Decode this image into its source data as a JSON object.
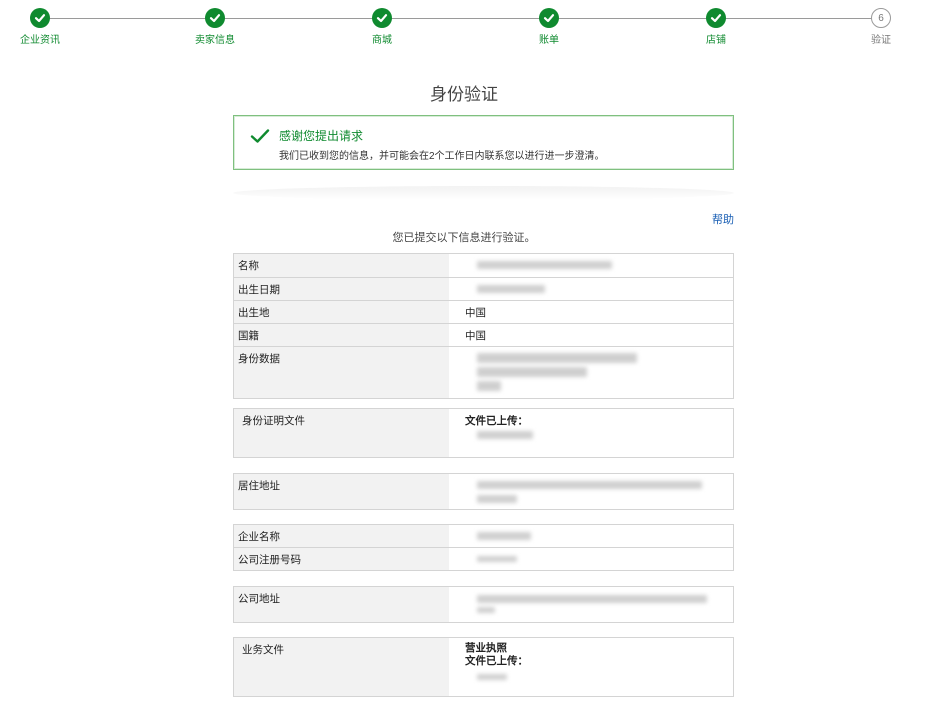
{
  "stepper": {
    "steps": [
      {
        "label": "企业资讯",
        "status": "done"
      },
      {
        "label": "卖家信息",
        "status": "done"
      },
      {
        "label": "商城",
        "status": "done"
      },
      {
        "label": "账单",
        "status": "done"
      },
      {
        "label": "店铺",
        "status": "done"
      },
      {
        "label": "验证",
        "status": "pending",
        "number": "6"
      }
    ]
  },
  "page_title": "身份验证",
  "success": {
    "title": "感谢您提出请求",
    "message": "我们已收到您的信息，并可能会在2个工作日内联系您以进行进一步澄清。",
    "icon": "checkmark-icon"
  },
  "help_label": "帮助",
  "submitted_note": "您已提交以下信息进行验证。",
  "identity": {
    "name_label": "名称",
    "birth_date_label": "出生日期",
    "birth_place_label": "出生地",
    "birth_place_value": "中国",
    "nationality_label": "国籍",
    "nationality_value": "中国",
    "id_data_label": "身份数据"
  },
  "id_proof": {
    "label": "身份证明文件",
    "status": "文件已上传："
  },
  "residence": {
    "label": "居住地址"
  },
  "company": {
    "name_label": "企业名称",
    "reg_no_label": "公司注册号码"
  },
  "company_address": {
    "label": "公司地址"
  },
  "business_docs": {
    "label": "业务文件",
    "doc_type": "营业执照",
    "status": "文件已上传："
  },
  "colors": {
    "success_green": "#0f8a2f",
    "link_blue": "#1a5fb4",
    "border": "#d4d4d4",
    "key_bg": "#f2f2f2"
  }
}
